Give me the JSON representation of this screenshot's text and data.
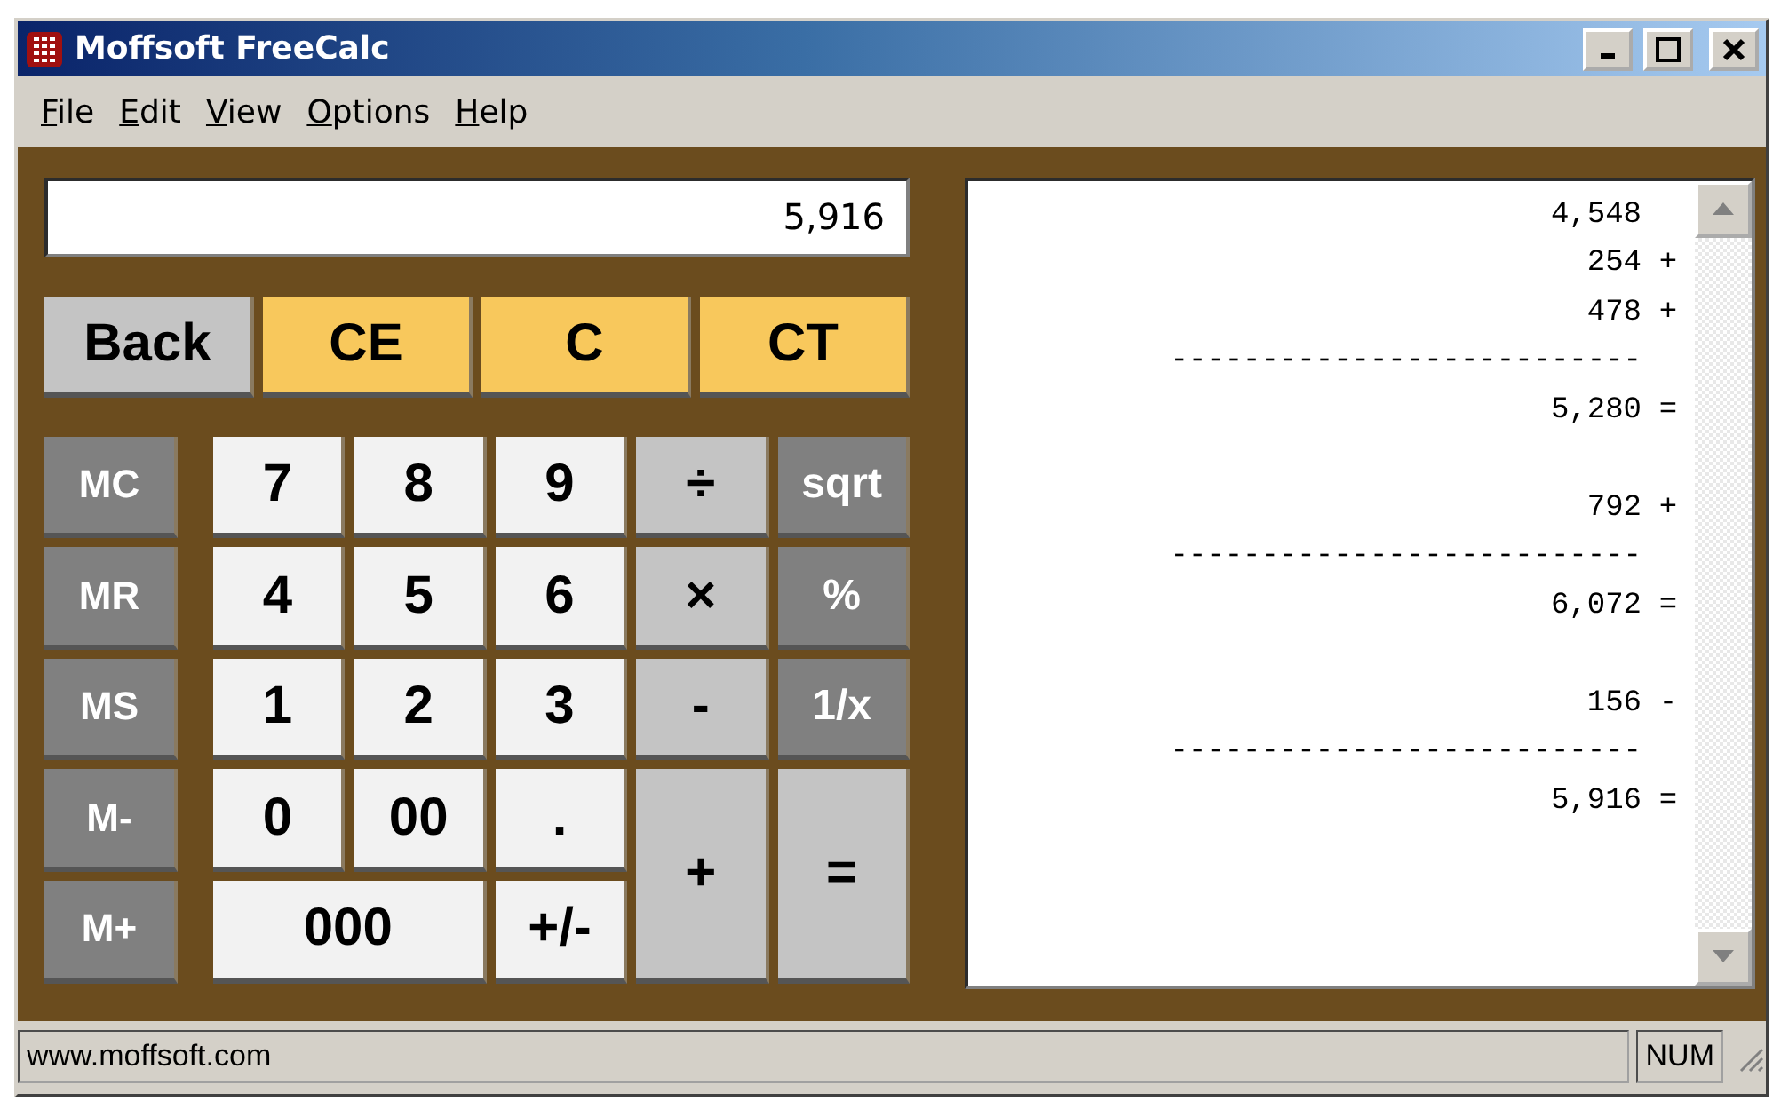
{
  "window": {
    "title": "Moffsoft FreeCalc",
    "controls": [
      {
        "kind": "minimize"
      },
      {
        "kind": "maximize"
      },
      {
        "kind": "close"
      }
    ]
  },
  "menu": [
    {
      "label": "File"
    },
    {
      "label": "Edit"
    },
    {
      "label": "View"
    },
    {
      "label": "Options"
    },
    {
      "label": "Help"
    }
  ],
  "display": {
    "value": "5,916"
  },
  "clear_keys": [
    {
      "label": "Back",
      "kind": "back"
    },
    {
      "label": "CE",
      "kind": "clear"
    },
    {
      "label": "C",
      "kind": "clear"
    },
    {
      "label": "CT",
      "kind": "clear"
    }
  ],
  "memory_keys": [
    "MC",
    "MR",
    "MS",
    "M-",
    "M+"
  ],
  "keys": [
    {
      "label": "7",
      "kind": "digit"
    },
    {
      "label": "8",
      "kind": "digit"
    },
    {
      "label": "9",
      "kind": "digit"
    },
    {
      "label": "÷",
      "kind": "operator"
    },
    {
      "label": "sqrt",
      "kind": "function"
    },
    {
      "label": "4",
      "kind": "digit"
    },
    {
      "label": "5",
      "kind": "digit"
    },
    {
      "label": "6",
      "kind": "digit"
    },
    {
      "label": "×",
      "kind": "operator"
    },
    {
      "label": "%",
      "kind": "function"
    },
    {
      "label": "1",
      "kind": "digit"
    },
    {
      "label": "2",
      "kind": "digit"
    },
    {
      "label": "3",
      "kind": "digit"
    },
    {
      "label": "-",
      "kind": "operator"
    },
    {
      "label": "1/x",
      "kind": "function"
    },
    {
      "label": "0",
      "kind": "digit"
    },
    {
      "label": "00",
      "kind": "digit"
    },
    {
      "label": ".",
      "kind": "digit"
    },
    {
      "label": "+",
      "kind": "tall"
    },
    {
      "label": "=",
      "kind": "tall"
    },
    {
      "label": "000",
      "kind": "wide"
    },
    {
      "label": "+/-",
      "kind": "digit"
    }
  ],
  "tape": [
    {
      "kind": "entry",
      "value": "4,548"
    },
    {
      "kind": "entry",
      "value": "254",
      "op": "+"
    },
    {
      "kind": "entry",
      "value": "478",
      "op": "+"
    },
    {
      "kind": "rule",
      "text": "--------------------------"
    },
    {
      "kind": "entry",
      "value": "5,280",
      "op": "="
    },
    {
      "kind": "blank"
    },
    {
      "kind": "entry",
      "value": "792",
      "op": "+"
    },
    {
      "kind": "rule",
      "text": "--------------------------"
    },
    {
      "kind": "entry",
      "value": "6,072",
      "op": "="
    },
    {
      "kind": "blank"
    },
    {
      "kind": "entry",
      "value": "156",
      "op": "-"
    },
    {
      "kind": "rule",
      "text": "--------------------------"
    },
    {
      "kind": "entry",
      "value": "5,916",
      "op": "="
    }
  ],
  "status_bar": {
    "text": "www.moffsoft.com",
    "indicator": "NUM"
  }
}
